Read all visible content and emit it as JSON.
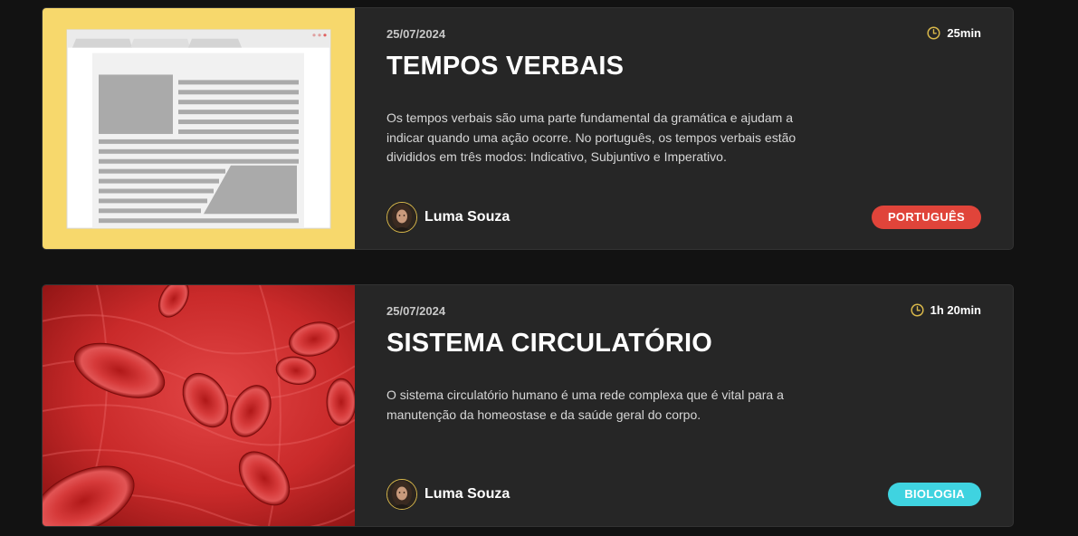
{
  "cards": [
    {
      "date": "25/07/2024",
      "duration": "25min",
      "title": "TEMPOS VERBAIS",
      "description": "Os tempos verbais são uma parte fundamental da gramática e ajudam a indicar quando uma ação ocorre. No português, os tempos verbais estão divididos em três modos: Indicativo, Subjuntivo e Imperativo.",
      "author": "Luma Souza",
      "tag": "PORTUGUÊS",
      "tag_color": "#e0443a",
      "thumbnail": "document-illustration"
    },
    {
      "date": "25/07/2024",
      "duration": "1h 20min",
      "title": "SISTEMA CIRCULATÓRIO",
      "description": "O sistema circulatório humano é uma rede complexa que é vital para a manutenção da homeostase e da saúde geral do corpo.",
      "author": "Luma Souza",
      "tag": "BIOLOGIA",
      "tag_color": "#3fd3e0",
      "thumbnail": "red-blood-cells-image"
    }
  ],
  "icons": {
    "duration": "clock-icon",
    "author": "avatar"
  },
  "colors": {
    "background": "#121212",
    "card": "#262626",
    "accent": "#d9b84a"
  }
}
